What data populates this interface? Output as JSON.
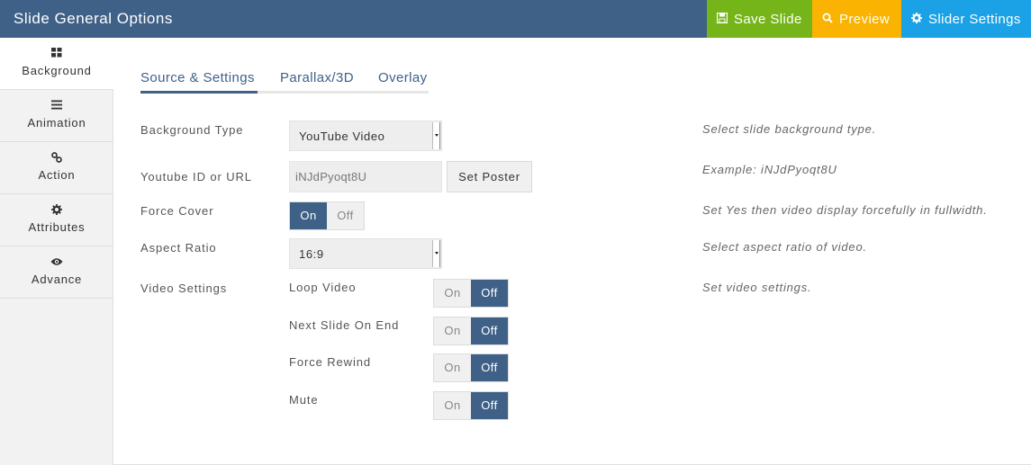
{
  "header": {
    "title": "Slide General Options",
    "buttons": [
      {
        "label": "Save Slide",
        "icon": "floppy-icon",
        "color": "#75b51a"
      },
      {
        "label": "Preview",
        "icon": "search-icon",
        "color": "#f9b300"
      },
      {
        "label": "Slider Settings",
        "icon": "gear-icon",
        "color": "#1aa1e6"
      }
    ],
    "color": "#3f6187"
  },
  "sidebar": {
    "items": [
      {
        "label": "Background",
        "icon": "grid-icon",
        "active": true
      },
      {
        "label": "Animation",
        "icon": "bars-icon",
        "active": false
      },
      {
        "label": "Action",
        "icon": "link-icon",
        "active": false
      },
      {
        "label": "Attributes",
        "icon": "gear-icon",
        "active": false
      },
      {
        "label": "Advance",
        "icon": "eye-icon",
        "active": false
      }
    ]
  },
  "tabs": [
    {
      "label": "Source & Settings",
      "active": true
    },
    {
      "label": "Parallax/3D",
      "active": false
    },
    {
      "label": "Overlay",
      "active": false
    }
  ],
  "form": {
    "background_type": {
      "label": "Background Type",
      "value": "YouTube Video",
      "help": "Select slide background type."
    },
    "youtube_id": {
      "label": "Youtube ID or URL",
      "value": "iNJdPyoqt8U",
      "button": "Set Poster",
      "help": "Example: iNJdPyoqt8U"
    },
    "force_cover": {
      "label": "Force Cover",
      "on_label": "On",
      "off_label": "Off",
      "value": "On",
      "help": "Set Yes then video display forcefully in fullwidth."
    },
    "aspect_ratio": {
      "label": "Aspect Ratio",
      "value": "16:9",
      "help": "Select aspect ratio of video."
    },
    "video_settings": {
      "label": "Video Settings",
      "help": "Set video settings.",
      "options": [
        {
          "label": "Loop Video",
          "on_label": "On",
          "off_label": "Off",
          "value": "Off"
        },
        {
          "label": "Next Slide On End",
          "on_label": "On",
          "off_label": "Off",
          "value": "Off"
        },
        {
          "label": "Force Rewind",
          "on_label": "On",
          "off_label": "Off",
          "value": "Off"
        },
        {
          "label": "Mute",
          "on_label": "On",
          "off_label": "Off",
          "value": "Off"
        }
      ]
    }
  }
}
